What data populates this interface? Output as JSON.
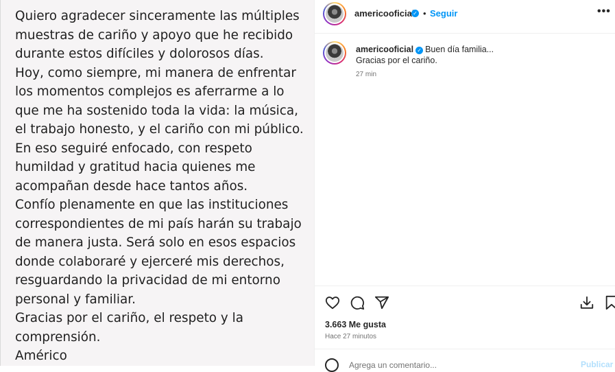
{
  "post_image": {
    "lines": [
      "Quiero agradecer sinceramente las múltiples",
      "muestras de cariño y apoyo que he recibido",
      "durante estos difíciles y dolorosos días.",
      "Hoy, como siempre, mi manera de enfrentar",
      "los momentos complejos es aferrarme a lo",
      "que me ha sostenido toda la vida: la música,",
      "el trabajo honesto, y el cariño con mi público.",
      "En eso seguiré enfocado, con respeto",
      "humildad y gratitud hacia quienes me",
      "acompañan desde hace tantos años.",
      "Confío plenamente en que las instituciones",
      "correspondientes de mi país harán su trabajo",
      "de manera justa. Será solo en esos espacios",
      "donde colaboraré y ejerceré mis derechos,",
      "resguardando la privacidad de mi entorno",
      "personal y familiar.",
      "Gracias por el cariño, el respeto y la",
      "comprensión.",
      "Américo"
    ]
  },
  "header": {
    "username": "americooficial",
    "verified_glyph": "✓",
    "separator": "•",
    "follow_label": "Seguir",
    "more_label": "•••"
  },
  "caption": {
    "username": "americooficial",
    "line1": "Buen día familia...",
    "line2": "Gracias por el cariño.",
    "time": "27 min"
  },
  "actions": {
    "icons": [
      "heart-icon",
      "comment-icon",
      "share-icon",
      "download-icon",
      "bookmark-icon"
    ]
  },
  "stats": {
    "likes": "3.663 Me gusta",
    "time_ago": "Hace 27 minutos"
  },
  "comment_box": {
    "placeholder": "Agrega un comentario...",
    "publish_label": "Publicar"
  },
  "colors": {
    "accent": "#0095f6",
    "publish_disabled": "#b2dffc",
    "muted_text": "#737373",
    "post_background": "#f6f4f5"
  }
}
